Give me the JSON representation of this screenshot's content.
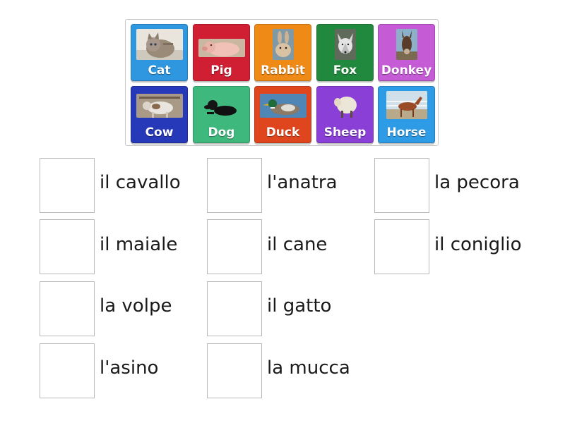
{
  "tiles": [
    {
      "label": "Cat",
      "color": "#2f97e0",
      "image": "cat-photo"
    },
    {
      "label": "Pig",
      "color": "#d01f33",
      "image": "pig-photo"
    },
    {
      "label": "Rabbit",
      "color": "#f08a16",
      "image": "rabbit-photo"
    },
    {
      "label": "Fox",
      "color": "#21893e",
      "image": "fox-photo"
    },
    {
      "label": "Donkey",
      "color": "#c55cd6",
      "image": "donkey-photo"
    },
    {
      "label": "Cow",
      "color": "#2639b8",
      "image": "cow-photo"
    },
    {
      "label": "Dog",
      "color": "#3fb87d",
      "image": "dog-photo"
    },
    {
      "label": "Duck",
      "color": "#e0461e",
      "image": "duck-photo"
    },
    {
      "label": "Sheep",
      "color": "#8a3fd6",
      "image": "sheep-photo"
    },
    {
      "label": "Horse",
      "color": "#2d9be6",
      "image": "horse-photo"
    }
  ],
  "targets": [
    {
      "word": "il cavallo"
    },
    {
      "word": "l'anatra"
    },
    {
      "word": "la pecora"
    },
    {
      "word": "il maiale"
    },
    {
      "word": "il cane"
    },
    {
      "word": "il coniglio"
    },
    {
      "word": "la volpe"
    },
    {
      "word": "il gatto"
    },
    {
      "word": "l'asino"
    },
    {
      "word": "la mucca"
    }
  ]
}
